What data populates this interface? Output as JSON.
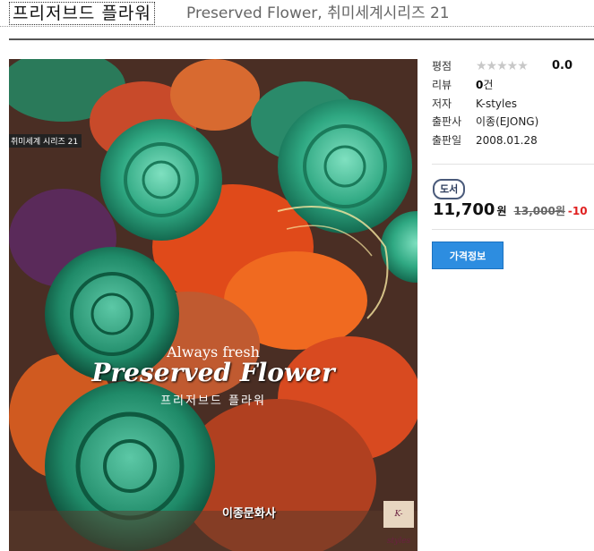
{
  "header": {
    "title": "프리저브드 플라워",
    "subtitle": "Preserved Flower, 취미세계시리즈 21"
  },
  "cover": {
    "series_tag": "취미세계 시리즈 21",
    "tagline": "Always fresh",
    "title_en": "Preserved Flower",
    "title_kr": "프리저브드 플라워",
    "publisher_logo": "이종문화사",
    "brand_tag": "K-styles"
  },
  "info": {
    "rating_label": "평점",
    "stars": "★★★★★",
    "rating_value": "0.0",
    "review_label": "리뷰",
    "review_count": "0",
    "review_unit": "건",
    "author_label": "저자",
    "author": "K-styles",
    "publisher_label": "출판사",
    "publisher": "이종(EJONG)",
    "pubdate_label": "출판일",
    "pubdate": "2008.01.28"
  },
  "price": {
    "badge": "도서",
    "sale": "11,700",
    "unit": "원",
    "original": "13,000원",
    "discount": "-10"
  },
  "actions": {
    "price_info_button": "가격정보"
  },
  "colors": {
    "button_blue": "#2d8de0",
    "discount_red": "#e02020"
  }
}
